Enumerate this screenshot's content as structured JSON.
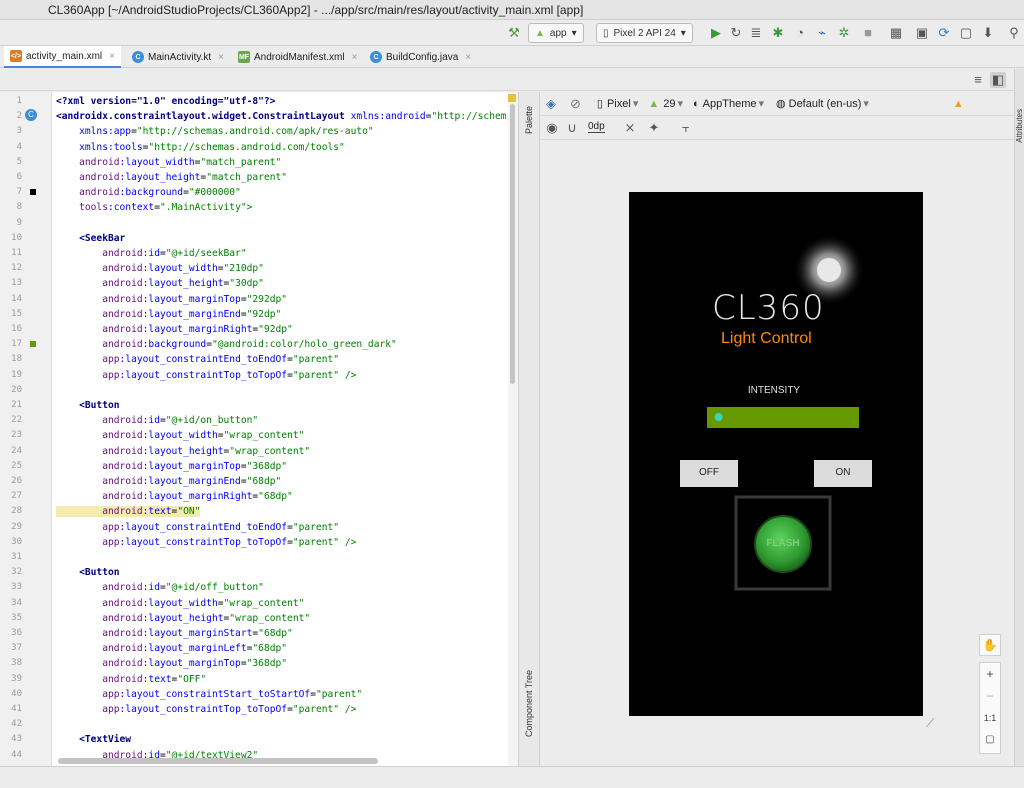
{
  "window": {
    "title": "CL360App [~/AndroidStudioProjects/CL360App2] - .../app/src/main/res/layout/activity_main.xml [app]"
  },
  "toolbar": {
    "config": "app",
    "device": "Pixel 2 API 24"
  },
  "tabs": [
    {
      "label": "activity_main.xml",
      "icon": "xml-file-icon",
      "color": "#d97d2c"
    },
    {
      "label": "MainActivity.kt",
      "icon": "kotlin-class-icon",
      "color": "#3a8fd9"
    },
    {
      "label": "AndroidManifest.xml",
      "icon": "manifest-file-icon",
      "color": "#6aa84f"
    },
    {
      "label": "BuildConfig.java",
      "icon": "java-class-icon",
      "color": "#3a8fd9"
    }
  ],
  "code_lines": [
    [
      {
        "t": "<?xml version=\"1.0\" encoding=\"utf-8\"?>",
        "c": "#000080"
      }
    ],
    [
      {
        "t": "<androidx.constraintlayout.widget.ConstraintLayout ",
        "c": "#000080"
      },
      {
        "t": "xmlns:android",
        "c": "#0000ff"
      },
      {
        "t": "=",
        "c": "#000"
      },
      {
        "t": "\"http://schem",
        "c": "#008000"
      }
    ],
    [
      {
        "t": "    xmlns:app",
        "c": "#0000ff"
      },
      {
        "t": "=",
        "c": "#000"
      },
      {
        "t": "\"http://schemas.android.com/apk/res-auto\"",
        "c": "#008000"
      }
    ],
    [
      {
        "t": "    xmlns:tools",
        "c": "#0000ff"
      },
      {
        "t": "=",
        "c": "#000"
      },
      {
        "t": "\"http://schemas.android.com/tools\"",
        "c": "#008000"
      }
    ],
    [
      {
        "t": "    android",
        "c": "#660e7a"
      },
      {
        "t": ":layout_width",
        "c": "#0000ff"
      },
      {
        "t": "=",
        "c": "#000"
      },
      {
        "t": "\"match_parent\"",
        "c": "#008000"
      }
    ],
    [
      {
        "t": "    android",
        "c": "#660e7a"
      },
      {
        "t": ":layout_height",
        "c": "#0000ff"
      },
      {
        "t": "=",
        "c": "#000"
      },
      {
        "t": "\"match_parent\"",
        "c": "#008000"
      }
    ],
    [
      {
        "t": "    android",
        "c": "#660e7a"
      },
      {
        "t": ":background",
        "c": "#0000ff"
      },
      {
        "t": "=",
        "c": "#000"
      },
      {
        "t": "\"#000000\"",
        "c": "#008000"
      }
    ],
    [
      {
        "t": "    tools",
        "c": "#660e7a"
      },
      {
        "t": ":context",
        "c": "#0000ff"
      },
      {
        "t": "=",
        "c": "#000"
      },
      {
        "t": "\".MainActivity\">",
        "c": "#008000"
      }
    ],
    [],
    [
      {
        "t": "    <SeekBar",
        "c": "#000080"
      }
    ],
    [
      {
        "t": "        android",
        "c": "#660e7a"
      },
      {
        "t": ":id",
        "c": "#0000ff"
      },
      {
        "t": "=",
        "c": "#000"
      },
      {
        "t": "\"@+id/seekBar\"",
        "c": "#008000"
      }
    ],
    [
      {
        "t": "        android",
        "c": "#660e7a"
      },
      {
        "t": ":layout_width",
        "c": "#0000ff"
      },
      {
        "t": "=",
        "c": "#000"
      },
      {
        "t": "\"210dp\"",
        "c": "#008000"
      }
    ],
    [
      {
        "t": "        android",
        "c": "#660e7a"
      },
      {
        "t": ":layout_height",
        "c": "#0000ff"
      },
      {
        "t": "=",
        "c": "#000"
      },
      {
        "t": "\"30dp\"",
        "c": "#008000"
      }
    ],
    [
      {
        "t": "        android",
        "c": "#660e7a"
      },
      {
        "t": ":layout_marginTop",
        "c": "#0000ff"
      },
      {
        "t": "=",
        "c": "#000"
      },
      {
        "t": "\"292dp\"",
        "c": "#008000"
      }
    ],
    [
      {
        "t": "        android",
        "c": "#660e7a"
      },
      {
        "t": ":layout_marginEnd",
        "c": "#0000ff"
      },
      {
        "t": "=",
        "c": "#000"
      },
      {
        "t": "\"92dp\"",
        "c": "#008000"
      }
    ],
    [
      {
        "t": "        android",
        "c": "#660e7a"
      },
      {
        "t": ":layout_marginRight",
        "c": "#0000ff"
      },
      {
        "t": "=",
        "c": "#000"
      },
      {
        "t": "\"92dp\"",
        "c": "#008000"
      }
    ],
    [
      {
        "t": "        android",
        "c": "#660e7a"
      },
      {
        "t": ":background",
        "c": "#0000ff"
      },
      {
        "t": "=",
        "c": "#000"
      },
      {
        "t": "\"@android:color/holo_green_dark\"",
        "c": "#008000"
      }
    ],
    [
      {
        "t": "        app",
        "c": "#660e7a"
      },
      {
        "t": ":layout_constraintEnd_toEndOf",
        "c": "#0000ff"
      },
      {
        "t": "=",
        "c": "#000"
      },
      {
        "t": "\"parent\"",
        "c": "#008000"
      }
    ],
    [
      {
        "t": "        app",
        "c": "#660e7a"
      },
      {
        "t": ":layout_constraintTop_toTopOf",
        "c": "#0000ff"
      },
      {
        "t": "=",
        "c": "#000"
      },
      {
        "t": "\"parent\" />",
        "c": "#008000"
      }
    ],
    [],
    [
      {
        "t": "    <Button",
        "c": "#000080"
      }
    ],
    [
      {
        "t": "        android",
        "c": "#660e7a"
      },
      {
        "t": ":id",
        "c": "#0000ff"
      },
      {
        "t": "=",
        "c": "#000"
      },
      {
        "t": "\"@+id/on_button\"",
        "c": "#008000"
      }
    ],
    [
      {
        "t": "        android",
        "c": "#660e7a"
      },
      {
        "t": ":layout_width",
        "c": "#0000ff"
      },
      {
        "t": "=",
        "c": "#000"
      },
      {
        "t": "\"wrap_content\"",
        "c": "#008000"
      }
    ],
    [
      {
        "t": "        android",
        "c": "#660e7a"
      },
      {
        "t": ":layout_height",
        "c": "#0000ff"
      },
      {
        "t": "=",
        "c": "#000"
      },
      {
        "t": "\"wrap_content\"",
        "c": "#008000"
      }
    ],
    [
      {
        "t": "        android",
        "c": "#660e7a"
      },
      {
        "t": ":layout_marginTop",
        "c": "#0000ff"
      },
      {
        "t": "=",
        "c": "#000"
      },
      {
        "t": "\"368dp\"",
        "c": "#008000"
      }
    ],
    [
      {
        "t": "        android",
        "c": "#660e7a"
      },
      {
        "t": ":layout_marginEnd",
        "c": "#0000ff"
      },
      {
        "t": "=",
        "c": "#000"
      },
      {
        "t": "\"68dp\"",
        "c": "#008000"
      }
    ],
    [
      {
        "t": "        android",
        "c": "#660e7a"
      },
      {
        "t": ":layout_marginRight",
        "c": "#0000ff"
      },
      {
        "t": "=",
        "c": "#000"
      },
      {
        "t": "\"68dp\"",
        "c": "#008000"
      }
    ],
    [
      {
        "t": "        android",
        "c": "#660e7a"
      },
      {
        "t": ":text",
        "c": "#0000ff"
      },
      {
        "t": "=",
        "c": "#000"
      },
      {
        "t": "\"ON\"",
        "c": "#008000"
      }
    ],
    [
      {
        "t": "        app",
        "c": "#660e7a"
      },
      {
        "t": ":layout_constraintEnd_toEndOf",
        "c": "#0000ff"
      },
      {
        "t": "=",
        "c": "#000"
      },
      {
        "t": "\"parent\"",
        "c": "#008000"
      }
    ],
    [
      {
        "t": "        app",
        "c": "#660e7a"
      },
      {
        "t": ":layout_constraintTop_toTopOf",
        "c": "#0000ff"
      },
      {
        "t": "=",
        "c": "#000"
      },
      {
        "t": "\"parent\" />",
        "c": "#008000"
      }
    ],
    [],
    [
      {
        "t": "    <Button",
        "c": "#000080"
      }
    ],
    [
      {
        "t": "        android",
        "c": "#660e7a"
      },
      {
        "t": ":id",
        "c": "#0000ff"
      },
      {
        "t": "=",
        "c": "#000"
      },
      {
        "t": "\"@+id/off_button\"",
        "c": "#008000"
      }
    ],
    [
      {
        "t": "        android",
        "c": "#660e7a"
      },
      {
        "t": ":layout_width",
        "c": "#0000ff"
      },
      {
        "t": "=",
        "c": "#000"
      },
      {
        "t": "\"wrap_content\"",
        "c": "#008000"
      }
    ],
    [
      {
        "t": "        android",
        "c": "#660e7a"
      },
      {
        "t": ":layout_height",
        "c": "#0000ff"
      },
      {
        "t": "=",
        "c": "#000"
      },
      {
        "t": "\"wrap_content\"",
        "c": "#008000"
      }
    ],
    [
      {
        "t": "        android",
        "c": "#660e7a"
      },
      {
        "t": ":layout_marginStart",
        "c": "#0000ff"
      },
      {
        "t": "=",
        "c": "#000"
      },
      {
        "t": "\"68dp\"",
        "c": "#008000"
      }
    ],
    [
      {
        "t": "        android",
        "c": "#660e7a"
      },
      {
        "t": ":layout_marginLeft",
        "c": "#0000ff"
      },
      {
        "t": "=",
        "c": "#000"
      },
      {
        "t": "\"68dp\"",
        "c": "#008000"
      }
    ],
    [
      {
        "t": "        android",
        "c": "#660e7a"
      },
      {
        "t": ":layout_marginTop",
        "c": "#0000ff"
      },
      {
        "t": "=",
        "c": "#000"
      },
      {
        "t": "\"368dp\"",
        "c": "#008000"
      }
    ],
    [
      {
        "t": "        android",
        "c": "#660e7a"
      },
      {
        "t": ":text",
        "c": "#0000ff"
      },
      {
        "t": "=",
        "c": "#000"
      },
      {
        "t": "\"OFF\"",
        "c": "#008000"
      }
    ],
    [
      {
        "t": "        app",
        "c": "#660e7a"
      },
      {
        "t": ":layout_constraintStart_toStartOf",
        "c": "#0000ff"
      },
      {
        "t": "=",
        "c": "#000"
      },
      {
        "t": "\"parent\"",
        "c": "#008000"
      }
    ],
    [
      {
        "t": "        app",
        "c": "#660e7a"
      },
      {
        "t": ":layout_constraintTop_toTopOf",
        "c": "#0000ff"
      },
      {
        "t": "=",
        "c": "#000"
      },
      {
        "t": "\"parent\" />",
        "c": "#008000"
      }
    ],
    [],
    [
      {
        "t": "    <TextView",
        "c": "#000080"
      }
    ],
    [
      {
        "t": "        android",
        "c": "#660e7a"
      },
      {
        "t": ":id",
        "c": "#0000ff"
      },
      {
        "t": "=",
        "c": "#000"
      },
      {
        "t": "\"@+id/textView2\"",
        "c": "#008000"
      }
    ]
  ],
  "design_toolbar": {
    "device": "Pixel",
    "api": "29",
    "theme": "AppTheme",
    "locale": "Default (en-us)",
    "margin": "0dp"
  },
  "side_panels": {
    "palette": "Palette",
    "component_tree": "Component Tree",
    "attributes": "Attributes"
  },
  "phone": {
    "logo": "CL360",
    "subtitle": "Light Control",
    "intensity_label": "INTENSITY",
    "off_button": "OFF",
    "on_button": "ON",
    "flash_button": "FLASH",
    "seekbar_level": 0.05,
    "colors": {
      "bg": "#000000",
      "seekbar": "#669900",
      "thumb": "#33d6c2",
      "accent": "#ff8a00",
      "flash": "#3caf3c"
    }
  },
  "zoom": {
    "zoom_in": "+",
    "zoom_out": "−",
    "actual": "1:1"
  }
}
